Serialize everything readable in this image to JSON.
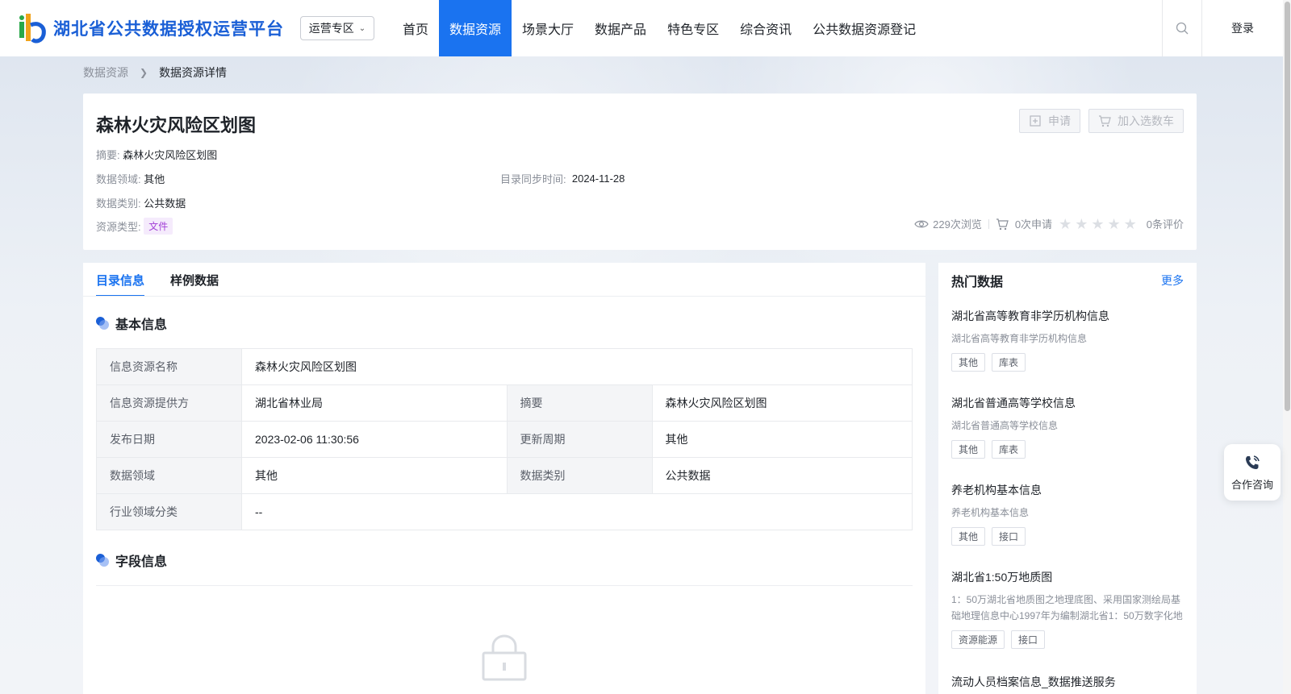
{
  "header": {
    "logo_text": "湖北省公共数据授权运营平台",
    "zone_select": "运营专区",
    "nav": [
      "首页",
      "数据资源",
      "场景大厅",
      "数据产品",
      "特色专区",
      "综合资讯",
      "公共数据资源登记"
    ],
    "active_nav_index": 1,
    "login": "登录"
  },
  "breadcrumb": {
    "parent": "数据资源",
    "current": "数据资源详情"
  },
  "detail": {
    "title": "森林火灾风险区划图",
    "summary_label": "摘要:",
    "summary_value": "森林火灾风险区划图",
    "domain_label": "数据领域:",
    "domain_value": "其他",
    "sync_label": "目录同步时间:",
    "sync_value": "2024-11-28",
    "category_label": "数据类别:",
    "category_value": "公共数据",
    "type_label": "资源类型:",
    "type_value": "文件",
    "apply_button": "申请",
    "cart_button": "加入选数车",
    "views": "229次浏览",
    "applies": "0次申请",
    "rating": 0,
    "rating_max": 5,
    "reviews": "0条评价"
  },
  "tabs": [
    "目录信息",
    "样例数据"
  ],
  "active_tab_index": 0,
  "basic_info": {
    "title": "基本信息",
    "rows": [
      [
        {
          "k": "信息资源名称",
          "v": "森林火灾风险区划图"
        }
      ],
      [
        {
          "k": "信息资源提供方",
          "v": "湖北省林业局"
        },
        {
          "k": "摘要",
          "v": "森林火灾风险区划图"
        }
      ],
      [
        {
          "k": "发布日期",
          "v": "2023-02-06 11:30:56"
        },
        {
          "k": "更新周期",
          "v": "其他"
        }
      ],
      [
        {
          "k": "数据领域",
          "v": "其他"
        },
        {
          "k": "数据类别",
          "v": "公共数据"
        }
      ],
      [
        {
          "k": "行业领域分类",
          "v": "--"
        }
      ]
    ]
  },
  "field_info": {
    "title": "字段信息"
  },
  "hot": {
    "title": "热门数据",
    "more": "更多",
    "items": [
      {
        "name": "湖北省高等教育非学历机构信息",
        "desc": "湖北省高等教育非学历机构信息",
        "tags": [
          "其他",
          "库表"
        ]
      },
      {
        "name": "湖北省普通高等学校信息",
        "desc": "湖北省普通高等学校信息",
        "tags": [
          "其他",
          "库表"
        ]
      },
      {
        "name": "养老机构基本信息",
        "desc": "养老机构基本信息",
        "tags": [
          "其他",
          "接口"
        ]
      },
      {
        "name": "湖北省1:50万地质图",
        "desc": "1：50万湖北省地质图之地理底图、采用国家测绘局基础地理信息中心1997年为编制湖北省1：50万数字化地",
        "tags": [
          "资源能源",
          "接口"
        ]
      },
      {
        "name": "流动人员档案信息_数据推送服务",
        "desc": "",
        "tags": []
      }
    ]
  },
  "consult": "合作咨询",
  "colors": {
    "primary": "#1a73f0",
    "logo": "#1a5fd6",
    "file_tag": "#a23fd6"
  }
}
